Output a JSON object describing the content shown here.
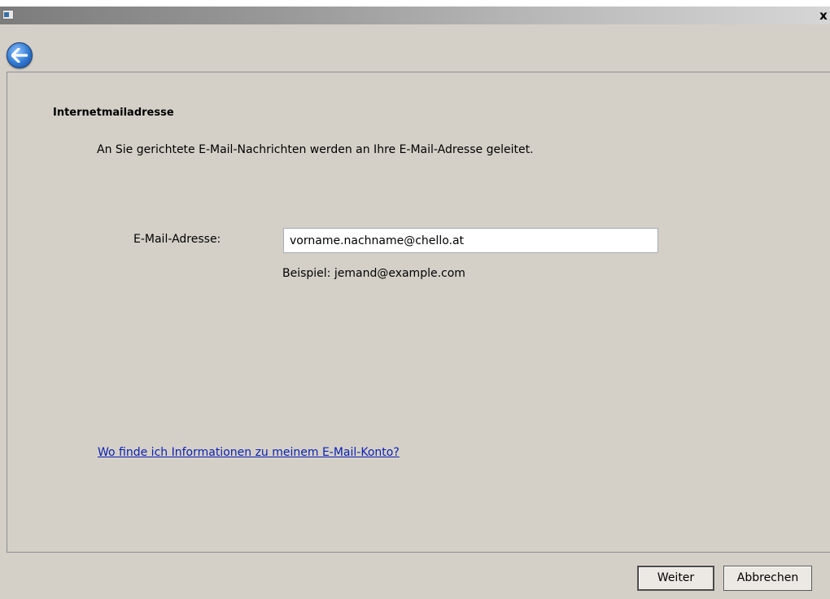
{
  "window": {
    "close_glyph": "x"
  },
  "navigation": {
    "back_icon": "arrow-left-icon"
  },
  "content": {
    "heading": "Internetmailadresse",
    "description": "An Sie gerichtete E-Mail-Nachrichten werden an Ihre E-Mail-Adresse geleitet.",
    "email_label": "E-Mail-Adresse:",
    "email_value": "vorname.nachname@chello.at",
    "example": "Beispiel: jemand@example.com",
    "help_link": "Wo finde ich Informationen zu meinem E-Mail-Konto?"
  },
  "footer": {
    "next_label": "Weiter",
    "cancel_label": "Abbrechen"
  },
  "colors": {
    "window_background": "#d4d0c8",
    "link": "#0b1fb0",
    "back_button": "#2f78d0"
  }
}
